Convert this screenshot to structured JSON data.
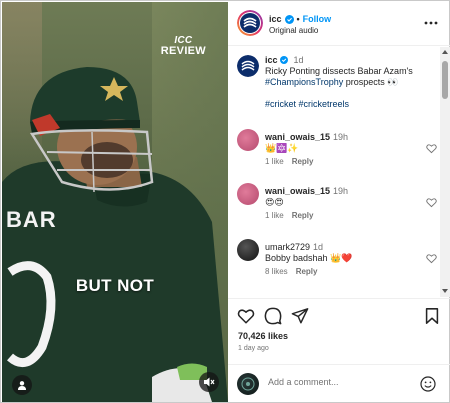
{
  "video": {
    "watermark_logo": "ICC",
    "watermark_text": "REVIEW",
    "jersey_text": "BAR",
    "caption_text": "BUT NOT"
  },
  "header": {
    "username": "icc",
    "separator": "•",
    "follow_label": "Follow",
    "subtitle": "Original audio"
  },
  "post": {
    "username": "icc",
    "time": "1d",
    "caption_prefix": "Ricky Ponting dissects Babar Azam's ",
    "caption_tag": "#ChampionsTrophy",
    "caption_suffix": " prospects 👀",
    "hashtags": "#cricket #cricketreels"
  },
  "comments": [
    {
      "username": "wani_owais_15",
      "time": "19h",
      "text": "👑🔯✨",
      "likes": "1 like",
      "reply": "Reply"
    },
    {
      "username": "wani_owais_15",
      "time": "19h",
      "text": "😍😍",
      "likes": "1 like",
      "reply": "Reply"
    },
    {
      "username": "umark2729",
      "time": "1d",
      "text": "Bobby badshah 👑❤️",
      "likes": "8 likes",
      "reply": "Reply"
    }
  ],
  "actions": {
    "likes": "70,426 likes",
    "posted": "1 day ago"
  },
  "add_comment": {
    "placeholder": "Add a comment..."
  },
  "colors": {
    "accent": "#0095f6",
    "hashtag": "#00376b",
    "muted": "#737373"
  }
}
